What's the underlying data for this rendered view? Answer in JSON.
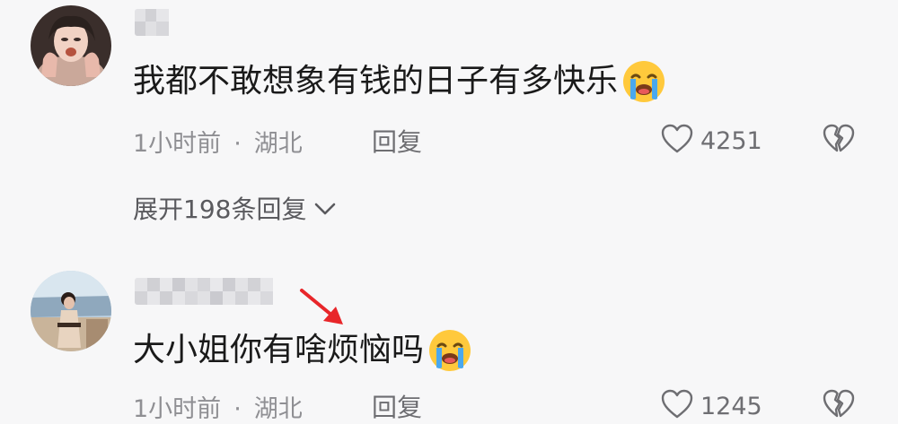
{
  "comments": [
    {
      "text": "我都不敢想象有钱的日子有多快乐",
      "time": "1小时前",
      "separator": "·",
      "location": "湖北",
      "reply_label": "回复",
      "likes": "4251",
      "emoji": "crying-emoji"
    },
    {
      "text": "大小姐你有啥烦恼吗",
      "time": "1小时前",
      "separator": "·",
      "location": "湖北",
      "reply_label": "回复",
      "likes": "1245",
      "emoji": "crying-emoji"
    }
  ],
  "expand_replies": {
    "label": "展开198条回复"
  },
  "colors": {
    "background": "#f7f7f8",
    "text": "#1a1a1a",
    "meta": "#8f8f93",
    "arrow": "#e8262a",
    "emoji_face": "#ffc93c",
    "emoji_tear": "#4aa8ee"
  }
}
